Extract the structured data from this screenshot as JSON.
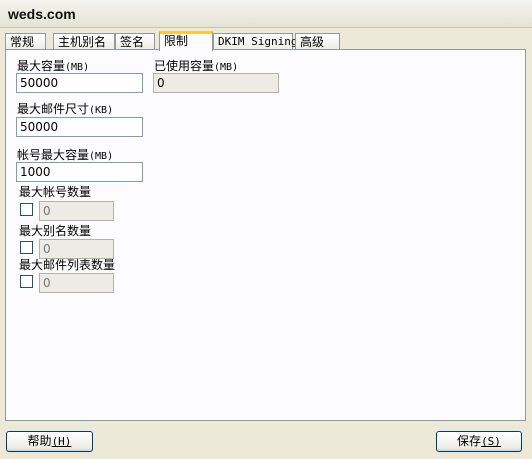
{
  "window": {
    "title": "weds.com"
  },
  "tabs": [
    {
      "label": "常规"
    },
    {
      "label": "主机别名"
    },
    {
      "label": "签名"
    },
    {
      "label": "限制"
    },
    {
      "label": "DKIM Signing"
    },
    {
      "label": "高级"
    }
  ],
  "active_tab": "限制",
  "limits": {
    "max_size": {
      "label": "最大容量",
      "unit": "(MB)",
      "value": "50000"
    },
    "used_size": {
      "label": "已使用容量",
      "unit": "(MB)",
      "value": "0"
    },
    "max_message_size": {
      "label": "最大邮件尺寸",
      "unit": "(KB)",
      "value": "50000"
    },
    "max_account_size": {
      "label": "帐号最大容量",
      "unit": "(MB)",
      "value": "1000"
    },
    "max_accounts": {
      "label": "最大帐号数量",
      "checked": false,
      "value": "0"
    },
    "max_aliases": {
      "label": "最大别名数量",
      "checked": false,
      "value": "0"
    },
    "max_lists": {
      "label": "最大邮件列表数量",
      "checked": false,
      "value": "0"
    }
  },
  "buttons": {
    "help": {
      "label": "帮助",
      "key": "(H)"
    },
    "save": {
      "label": "保存",
      "key": "(S)"
    }
  }
}
